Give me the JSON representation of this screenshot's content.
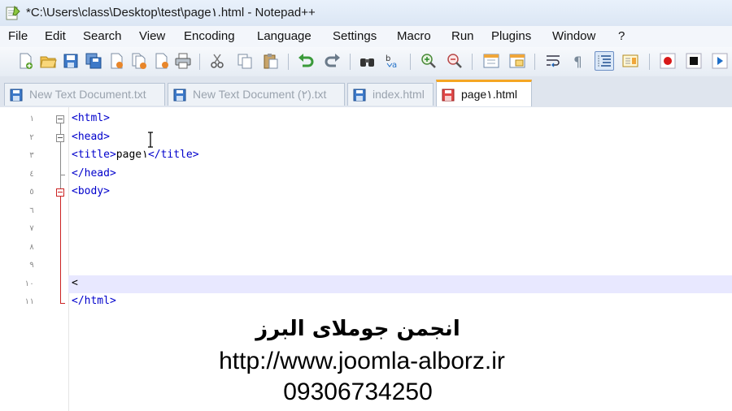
{
  "window": {
    "title": "*C:\\Users\\class\\Desktop\\test\\page١.html - Notepad++"
  },
  "menu": [
    "File",
    "Edit",
    "Search",
    "View",
    "Encoding",
    "Language",
    "Settings",
    "Macro",
    "Run",
    "Plugins",
    "Window",
    "?"
  ],
  "toolbar": {
    "icons": [
      "new-file-icon",
      "open-file-icon",
      "save-icon",
      "save-all-icon",
      "close-icon",
      "close-all-icon",
      "print-icon",
      "cut-icon",
      "copy-icon",
      "paste-icon",
      "undo-icon",
      "redo-icon",
      "find-icon",
      "replace-icon",
      "zoom-in-icon",
      "zoom-out-icon",
      "sync-vertical-icon",
      "sync-horizontal-icon",
      "word-wrap-icon",
      "show-all-characters-icon",
      "indent-guide-icon",
      "document-map-icon",
      "record-macro-icon",
      "stop-macro-icon",
      "play-macro-icon"
    ]
  },
  "tabs": [
    {
      "label": "New Text Document.txt",
      "active": false
    },
    {
      "label": "New Text Document (٢).txt",
      "active": false
    },
    {
      "label": "index.html",
      "active": false
    },
    {
      "label": "page١.html",
      "active": true
    }
  ],
  "editor": {
    "line_numbers": [
      "١",
      "٢",
      "٣",
      "٤",
      "٥",
      "٦",
      "٧",
      "٨",
      "٩",
      "١٠",
      "١١"
    ],
    "lines": [
      {
        "tag": "<html>",
        "text": "",
        "tag2": ""
      },
      {
        "tag": "<head>",
        "text": "",
        "tag2": ""
      },
      {
        "tag": "<title>",
        "text": "page١",
        "tag2": "</title>"
      },
      {
        "tag": "</head>",
        "text": "",
        "tag2": ""
      },
      {
        "tag": "<body>",
        "text": "",
        "tag2": ""
      },
      {
        "tag": "",
        "text": "",
        "tag2": ""
      },
      {
        "tag": "",
        "text": "",
        "tag2": ""
      },
      {
        "tag": "",
        "text": "",
        "tag2": ""
      },
      {
        "tag": "",
        "text": "",
        "tag2": ""
      },
      {
        "tag": "",
        "text": "<",
        "tag2": ""
      },
      {
        "tag": "</html>",
        "text": "",
        "tag2": ""
      }
    ],
    "current_line": 10
  },
  "overlay": {
    "name": "انجمن جوملای البرز",
    "url": "http://www.joomla-alborz.ir",
    "phone": "09306734250"
  }
}
